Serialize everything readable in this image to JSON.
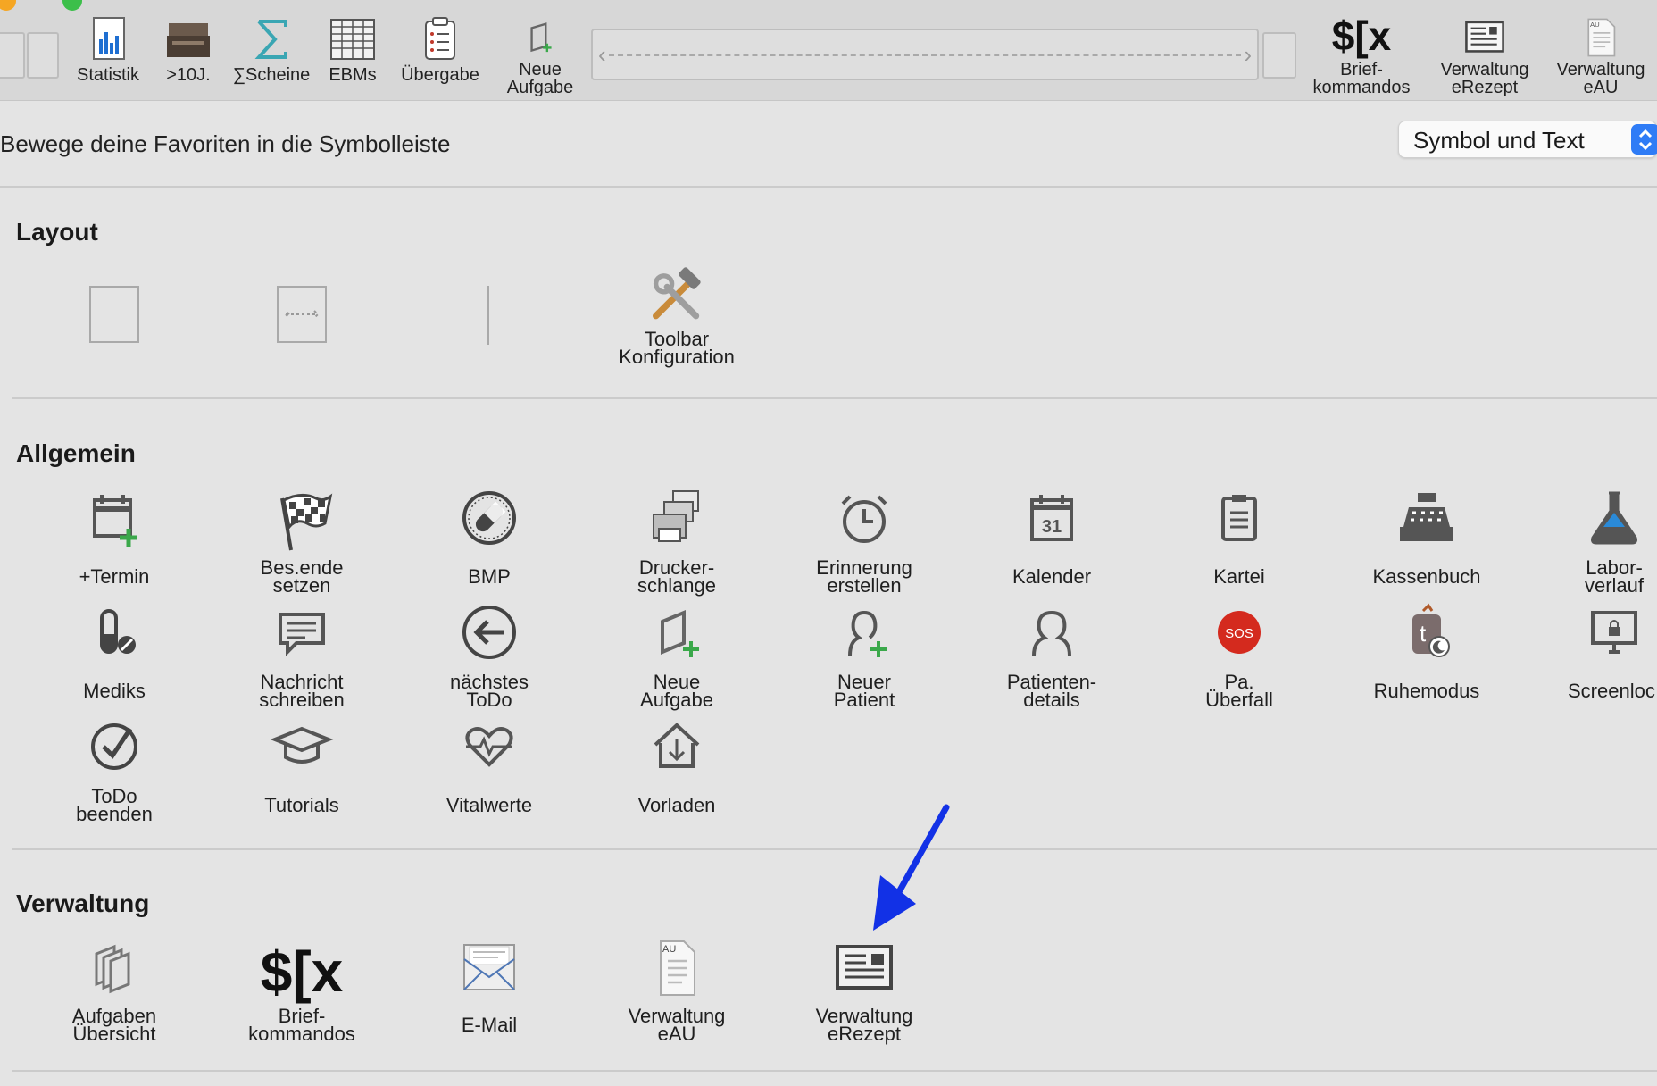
{
  "toolbar": {
    "items": [
      {
        "label": "Statistik",
        "icon": "bar-chart-icon"
      },
      {
        "label": ">10J.",
        "icon": "archive-box-icon"
      },
      {
        "label": "∑Scheine",
        "icon": "sigma-icon"
      },
      {
        "label": "EBMs",
        "icon": "grid-table-icon"
      },
      {
        "label": "Übergabe",
        "icon": "clipboard-list-icon"
      },
      {
        "label_1": "Neue",
        "label_2": "Aufgabe",
        "icon": "new-task-icon"
      },
      {
        "label_1": "Brief-",
        "label_2": "kommandos",
        "icon": "dollar-bracket-x-icon"
      },
      {
        "label_1": "Verwaltung",
        "label_2": "eRezept",
        "icon": "erezept-document-icon"
      },
      {
        "label_1": "Verwaltung",
        "label_2": "eAU",
        "icon": "eau-document-icon"
      }
    ]
  },
  "instruction": "Bewege deine Favoriten in die Symbolleiste",
  "display_select": {
    "value": "Symbol und Text"
  },
  "sections": {
    "layout": {
      "title": "Layout",
      "items": [
        {
          "name": "space",
          "icon": "space-item-icon"
        },
        {
          "name": "flexible-space",
          "icon": "flexible-space-icon"
        },
        {
          "name": "separator",
          "icon": "separator-icon"
        },
        {
          "label_1": "Toolbar",
          "label_2": "Konfiguration",
          "icon": "hammer-wrench-icon"
        }
      ]
    },
    "allgemein": {
      "title": "Allgemein",
      "items": [
        {
          "label": "+Termin",
          "icon": "calendar-plus-icon"
        },
        {
          "label_1": "Bes.ende",
          "label_2": "setzen",
          "icon": "checkered-flag-icon"
        },
        {
          "label": "BMP",
          "icon": "pill-circle-icon"
        },
        {
          "label_1": "Drucker-",
          "label_2": "schlange",
          "icon": "printer-queue-icon"
        },
        {
          "label_1": "Erinnerung",
          "label_2": "erstellen",
          "icon": "alarm-clock-icon"
        },
        {
          "label": "Kalender",
          "icon": "calendar-31-icon",
          "day": "31"
        },
        {
          "label": "Kartei",
          "icon": "clipboard-icon"
        },
        {
          "label": "Kassenbuch",
          "icon": "cash-register-icon"
        },
        {
          "label_1": "Labor-",
          "label_2": "verlauf",
          "icon": "lab-flask-icon"
        },
        {
          "label": "Mediks",
          "icon": "medication-icon"
        },
        {
          "label_1": "Nachricht",
          "label_2": "schreiben",
          "icon": "message-bubble-icon"
        },
        {
          "label_1": "nächstes",
          "label_2": "ToDo",
          "icon": "arrow-left-circle-icon"
        },
        {
          "label_1": "Neue",
          "label_2": "Aufgabe",
          "icon": "new-task-icon"
        },
        {
          "label_1": "Neuer",
          "label_2": "Patient",
          "icon": "person-plus-icon"
        },
        {
          "label_1": "Patienten-",
          "label_2": "details",
          "icon": "person-outline-icon"
        },
        {
          "label_1": "Pa.",
          "label_2": "Überfall",
          "icon": "sos-icon",
          "badge": "SOS"
        },
        {
          "label": "Ruhemodus",
          "icon": "sleep-mode-icon"
        },
        {
          "label": "Screenloc",
          "icon": "screen-lock-icon"
        },
        {
          "label_1": "ToDo",
          "label_2": "beenden",
          "icon": "check-circle-icon"
        },
        {
          "label": "Tutorials",
          "icon": "graduation-cap-icon"
        },
        {
          "label": "Vitalwerte",
          "icon": "heart-pulse-icon"
        },
        {
          "label": "Vorladen",
          "icon": "house-arrow-icon"
        }
      ]
    },
    "verwaltung": {
      "title": "Verwaltung",
      "items": [
        {
          "label_1": "Aufgaben",
          "label_2": "Übersicht",
          "icon": "tasks-overview-icon"
        },
        {
          "label_1": "Brief-",
          "label_2": "kommandos",
          "icon": "dollar-bracket-x-icon"
        },
        {
          "label": "E-Mail",
          "icon": "envelope-icon"
        },
        {
          "label_1": "Verwaltung",
          "label_2": "eAU",
          "icon": "eau-document-icon"
        },
        {
          "label_1": "Verwaltung",
          "label_2": "eRezept",
          "icon": "erezept-document-icon"
        }
      ]
    }
  },
  "glyphs": {
    "au": "AU",
    "dollar_bracket_x": "$[x"
  },
  "colors": {
    "accent": "#2f7cf6",
    "annotation_arrow": "#1231e6",
    "add_plus": "#3aa84a",
    "sos_red": "#d42a1e"
  }
}
